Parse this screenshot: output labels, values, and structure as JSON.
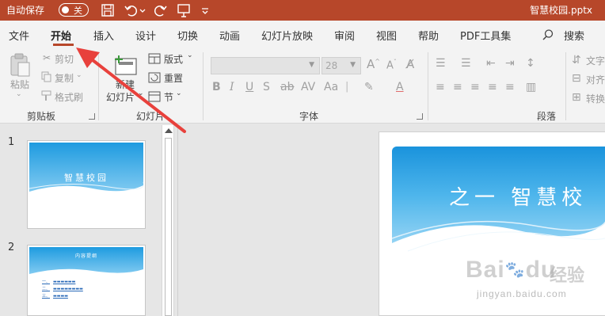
{
  "titlebar": {
    "autosave_label": "自动保存",
    "toggle_state": "关",
    "document_title": "智慧校园.pptx"
  },
  "menu": {
    "tabs": [
      "文件",
      "开始",
      "插入",
      "设计",
      "切换",
      "动画",
      "幻灯片放映",
      "审阅",
      "视图",
      "帮助",
      "PDF工具集",
      "搜索"
    ],
    "active_tab": "开始"
  },
  "ribbon": {
    "clipboard": {
      "paste": "粘贴",
      "cut": "剪切",
      "copy": "复制",
      "format_painter": "格式刷",
      "group_label": "剪贴板"
    },
    "slides": {
      "new_slide_line1": "新建",
      "new_slide_line2": "幻灯片",
      "layout": "版式",
      "reset": "重置",
      "section": "节",
      "group_label": "幻灯片"
    },
    "font": {
      "font_name": "",
      "font_size": "28",
      "group_label": "字体"
    },
    "paragraph": {
      "text_direction": "文字",
      "align_text": "对齐",
      "convert": "转换",
      "group_label": "段落"
    }
  },
  "slides_panel": {
    "slides": [
      {
        "number": "1",
        "title": "智慧校园"
      },
      {
        "number": "2",
        "title": "内容提纲",
        "items": [
          "一、",
          "二、",
          "三、"
        ]
      }
    ]
  },
  "main_slide": {
    "title": "之一  智慧校"
  },
  "watermark": {
    "brand": "Bai",
    "brand_suffix": "du",
    "cn": "经验",
    "url": "jingyan.baidu.com"
  },
  "colors": {
    "titlebar": "#b7472a",
    "accent": "#b7472a",
    "annotation_arrow": "#e8413c",
    "slide_sky_top": "#1a93dc",
    "slide_sky_bottom": "#a9dcf6"
  }
}
